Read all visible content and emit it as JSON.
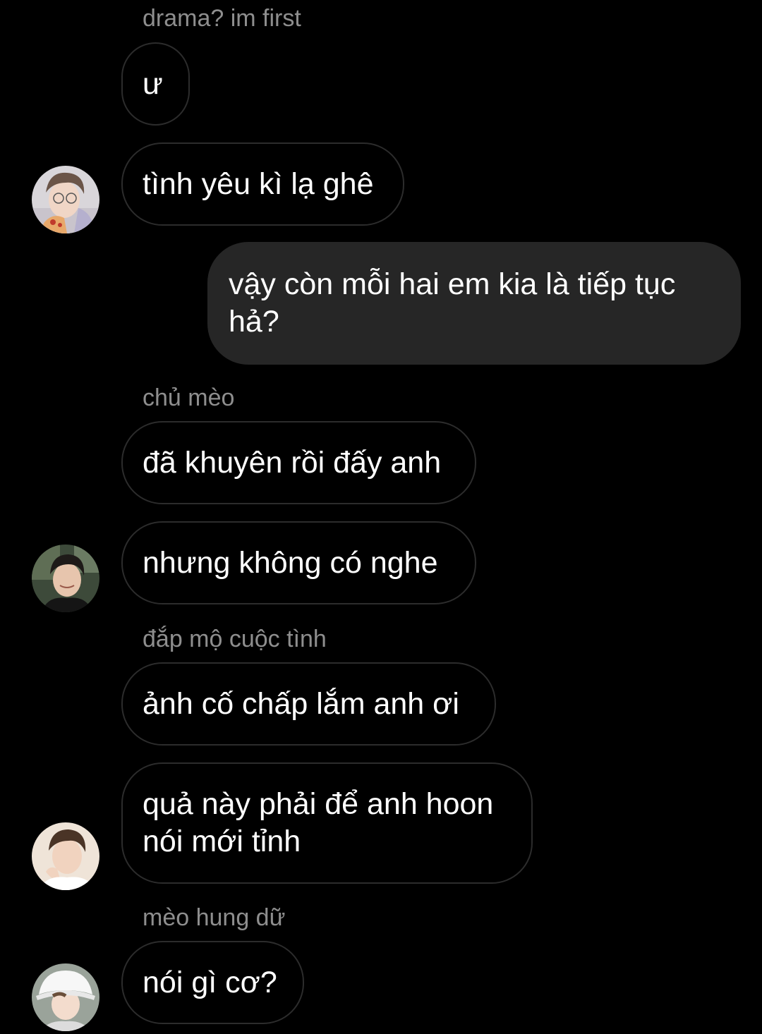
{
  "conversation": {
    "messages": [
      {
        "sender": "drama? im first",
        "text": "ư"
      },
      {
        "text": "tình yêu kì lạ ghê"
      },
      {
        "text_lines": [
          "vậy còn mỗi hai em kia là tiếp tục",
          "hả?"
        ]
      },
      {
        "sender": "chủ mèo",
        "text": "đã khuyên rồi đấy anh"
      },
      {
        "text": "nhưng không có nghe"
      },
      {
        "sender": "đắp mộ cuộc tình",
        "text": "ảnh cố chấp lắm anh ơi"
      },
      {
        "text_lines": [
          "quả này phải để anh hoon",
          "nói mới tỉnh"
        ]
      },
      {
        "sender": "mèo hung dữ",
        "text": "nói gì cơ?"
      }
    ]
  },
  "colors": {
    "background": "#000000",
    "incoming_bubble_border": "#2c2c2c",
    "outgoing_bubble": "#262626",
    "sender_name": "#8e8e8e",
    "message_text": "#ffffff"
  },
  "icons": {
    "avatar_1": "profile-photo-avatar",
    "avatar_2": "profile-photo-avatar",
    "avatar_3": "profile-photo-avatar",
    "avatar_4": "profile-photo-avatar"
  }
}
